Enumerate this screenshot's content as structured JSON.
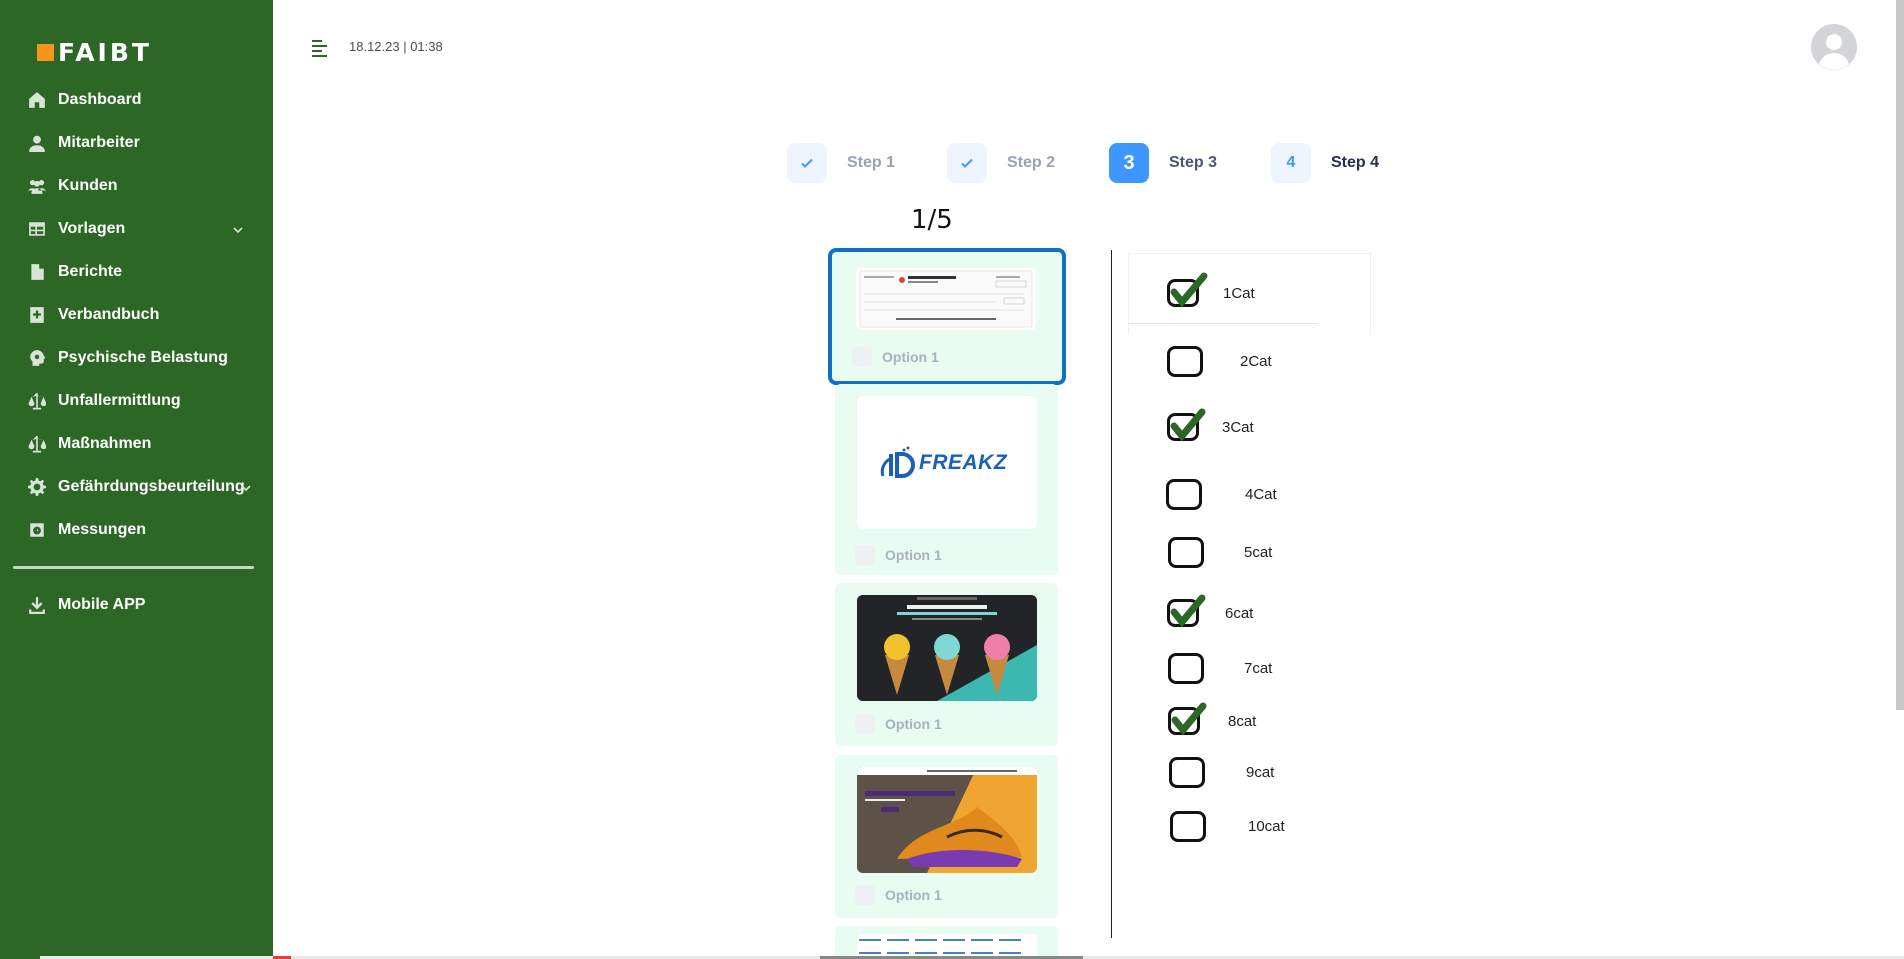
{
  "brand": {
    "name": "FAIBT"
  },
  "colors": {
    "sidebar": "#2c6726",
    "accent": "#3e97ff",
    "selected_border": "#1071c4",
    "card_bg": "#e8fcf1",
    "check": "#2c6726"
  },
  "sidebar": {
    "items": [
      {
        "label": "Dashboard",
        "icon": "home-icon"
      },
      {
        "label": "Mitarbeiter",
        "icon": "user-icon"
      },
      {
        "label": "Kunden",
        "icon": "users-icon"
      },
      {
        "label": "Vorlagen",
        "icon": "table-icon",
        "expandable": true
      },
      {
        "label": "Berichte",
        "icon": "document-icon"
      },
      {
        "label": "Verbandbuch",
        "icon": "medical-book-icon"
      },
      {
        "label": "Psychische Belastung",
        "icon": "brain-icon"
      },
      {
        "label": "Unfallermittlung",
        "icon": "scale-icon"
      },
      {
        "label": "Maßnahmen",
        "icon": "scale-icon"
      },
      {
        "label": "Gefährdungsbeurteilung",
        "icon": "gear-alert-icon",
        "expandable": true
      },
      {
        "label": "Messungen",
        "icon": "measure-icon"
      }
    ],
    "mobile_app": {
      "label": "Mobile APP",
      "icon": "download-icon"
    }
  },
  "header": {
    "datetime": "18.12.23 | 01:38"
  },
  "stepper": {
    "steps": [
      {
        "label": "Step 1",
        "state": "done"
      },
      {
        "label": "Step 2",
        "state": "done"
      },
      {
        "label": "Step 3",
        "number": "3",
        "state": "current"
      },
      {
        "label": "Step 4",
        "number": "4",
        "state": "pending"
      }
    ]
  },
  "pager": {
    "counter": "1/5"
  },
  "cards": [
    {
      "option": "Option 1",
      "thumbnail": "bank-check-document",
      "selected": true
    },
    {
      "option": "Option 1",
      "thumbnail": "idfreakz-logo",
      "logo_text": "FREAKZ"
    },
    {
      "option": "Option 1",
      "thumbnail": "ice-cream-banner"
    },
    {
      "option": "Option 1",
      "thumbnail": "sneaker-banner"
    },
    {
      "option": "",
      "thumbnail": "logo-pattern"
    }
  ],
  "categories": [
    {
      "label": "1Cat",
      "checked": true
    },
    {
      "label": "2Cat",
      "checked": false
    },
    {
      "label": "3Cat",
      "checked": true
    },
    {
      "label": "4Cat",
      "checked": false
    },
    {
      "label": "5cat",
      "checked": false
    },
    {
      "label": "6cat",
      "checked": true
    },
    {
      "label": "7cat",
      "checked": false
    },
    {
      "label": "8cat",
      "checked": true
    },
    {
      "label": "9cat",
      "checked": false
    },
    {
      "label": "10cat",
      "checked": false
    }
  ]
}
